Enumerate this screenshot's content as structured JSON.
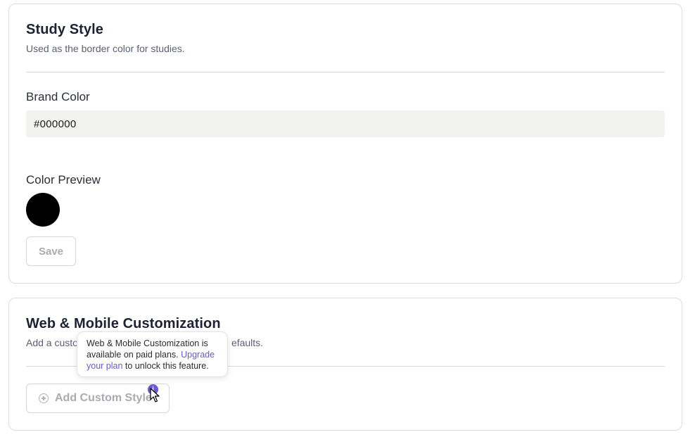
{
  "study_style": {
    "title": "Study Style",
    "description": "Used as the border color for studies.",
    "brand_color_label": "Brand Color",
    "brand_color_value": "#000000",
    "color_preview_label": "Color Preview",
    "preview_color": "#000000",
    "save_label": "Save"
  },
  "web_mobile": {
    "title": "Web & Mobile Customization",
    "description_visible_start": "Add a custo",
    "description_visible_end": "efaults.",
    "add_button_label": "Add Custom Style"
  },
  "tooltip": {
    "text_before": "Web & Mobile Customization is available on paid plans. ",
    "link_text": "Upgrade your plan",
    "text_after": " to unlock this feature."
  },
  "colors": {
    "accent": "#6b5bd2",
    "link": "#6a59c8",
    "input_bg": "#f2f2f1",
    "disabled_text": "#a9abb0"
  },
  "icons": {
    "info_badge": "info-icon",
    "add_icon": "plus-circle-icon",
    "cursor": "pointer-cursor-icon"
  }
}
